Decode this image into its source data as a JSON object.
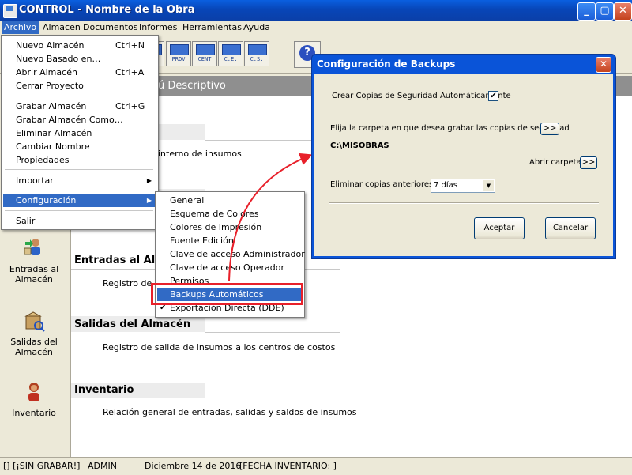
{
  "window": {
    "title": "CONTROL - Nombre de la Obra",
    "controls": {
      "minimize": "_",
      "maximize": "▢",
      "close": "✕"
    }
  },
  "menubar": {
    "items": [
      {
        "label": "Archivo"
      },
      {
        "label": "Almacen"
      },
      {
        "label": "Documentos"
      },
      {
        "label": "Informes"
      },
      {
        "label": "Herramientas"
      },
      {
        "label": "Ayuda"
      }
    ]
  },
  "toolbar": {
    "buttons": [
      {
        "label": ""
      },
      {
        "label": "PROV"
      },
      {
        "label": "CENT"
      },
      {
        "label": "C.E."
      },
      {
        "label": "C.S."
      }
    ],
    "help_label": "?"
  },
  "left_panel": {
    "items": [
      {
        "label": "Entradas al Almacén",
        "icon": "person-entry-icon"
      },
      {
        "label": "Salidas del Almacén",
        "icon": "box-exit-icon"
      },
      {
        "label": "Inventario",
        "icon": "person-inventory-icon"
      }
    ]
  },
  "main": {
    "header": "ú Descriptivo",
    "intro_text": "interno de insumos",
    "sections": [
      {
        "title": "Entradas al Alma",
        "desc": "Registro de ir"
      },
      {
        "title": "Salidas del Almacén",
        "desc": "Registro de salida de insumos a los centros de costos"
      },
      {
        "title": "Inventario",
        "desc": "Relación general de entradas, salidas y saldos de insumos"
      }
    ]
  },
  "archivo_menu": {
    "items": [
      {
        "label": "Nuevo Almacén",
        "shortcut": "Ctrl+N"
      },
      {
        "label": "Nuevo Basado en…",
        "shortcut": ""
      },
      {
        "label": "Abrir Almacén",
        "shortcut": "Ctrl+A"
      },
      {
        "label": "Cerrar Proyecto",
        "shortcut": ""
      },
      {
        "label": "Grabar Almacén",
        "shortcut": "Ctrl+G"
      },
      {
        "label": "Grabar Almacén Como…",
        "shortcut": ""
      },
      {
        "label": "Eliminar Almacén",
        "shortcut": ""
      },
      {
        "label": "Cambiar Nombre",
        "shortcut": ""
      },
      {
        "label": "Propiedades",
        "shortcut": ""
      },
      {
        "label": "Importar",
        "shortcut": ""
      },
      {
        "label": "Configuración",
        "shortcut": ""
      },
      {
        "label": "Salir",
        "shortcut": ""
      }
    ]
  },
  "config_submenu": {
    "items": [
      {
        "label": "General"
      },
      {
        "label": "Esquema de Colores"
      },
      {
        "label": "Colores de Impresión"
      },
      {
        "label": "Fuente Edición"
      },
      {
        "label": "Clave de acceso Administrador"
      },
      {
        "label": "Clave de acceso Operador"
      },
      {
        "label": "Permisos"
      },
      {
        "label": "Backups Automáticos"
      },
      {
        "label": "Exportación Directa (DDE)"
      }
    ],
    "selected": "Backups Automáticos",
    "checked": "Exportación Directa (DDE)"
  },
  "dialog": {
    "title": "Configuración de Backups",
    "auto_backup_label": "Crear Copias de Seguridad Automáticamente",
    "auto_backup_checked": true,
    "folder_prompt": "Elija la carpeta en que desea grabar las copias de seguridad",
    "browse_label": ">>",
    "folder_path": "C:\\MISOBRAS",
    "open_folder_label": "Abrir carpeta",
    "open_folder_button": ">>",
    "delete_label": "Eliminar copias anteriores a",
    "delete_value": "7 días",
    "ok_label": "Aceptar",
    "cancel_label": "Cancelar"
  },
  "statusbar": {
    "save_state": "[] [¡SIN GRABAR!]",
    "user": "ADMIN",
    "date": "Diciembre 14 de 2016",
    "inventory_date": "[FECHA INVENTARIO: ]"
  },
  "colors": {
    "menu_highlight": "#316ac5",
    "annotation_red": "#e8202a"
  }
}
